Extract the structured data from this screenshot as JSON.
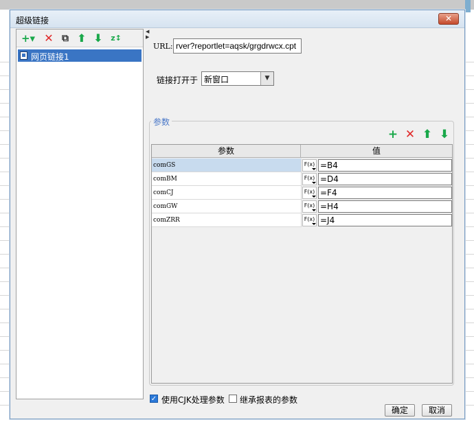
{
  "window": {
    "title": "超级链接",
    "close_symbol": "✕"
  },
  "left_toolbar": {
    "add_symbol": "+▾",
    "delete_symbol": "✕",
    "copy_symbol": "⧉",
    "up_symbol": "⬆",
    "down_symbol": "⬇",
    "sort_symbol": "z↕"
  },
  "tree": {
    "items": [
      {
        "label": "网页链接1",
        "selected": true
      }
    ]
  },
  "url": {
    "label": "URL:",
    "value": "rver?reportlet=aqsk/grgdrwcx.cpt"
  },
  "open_in": {
    "label": "链接打开于",
    "value": "新窗口",
    "dropdown_symbol": "▼"
  },
  "params": {
    "legend": "参数",
    "toolbar": {
      "add_symbol": "+",
      "delete_symbol": "✕",
      "up_symbol": "⬆",
      "down_symbol": "⬇"
    },
    "columns": [
      "参数",
      "值"
    ],
    "rows": [
      {
        "name": "comGS",
        "fx": "F(x)",
        "value": "=B4",
        "selected": true
      },
      {
        "name": "comBM",
        "fx": "F(x)",
        "value": "=D4"
      },
      {
        "name": "comCJ",
        "fx": "F(x)",
        "value": "=F4"
      },
      {
        "name": "comGW",
        "fx": "F(x)",
        "value": "=H4"
      },
      {
        "name": "comZRR",
        "fx": "F(x)",
        "value": "=J4"
      }
    ]
  },
  "options": {
    "use_cjk": {
      "label": "使用CJK处理参数",
      "checked": true,
      "check_symbol": "✓"
    },
    "inherit": {
      "label": "继承报表的参数",
      "checked": false
    }
  },
  "buttons": {
    "ok": "确定",
    "cancel": "取消"
  },
  "colors": {
    "accent_blue": "#3a75c4",
    "add_green": "#19a84a",
    "delete_red": "#e02828"
  }
}
